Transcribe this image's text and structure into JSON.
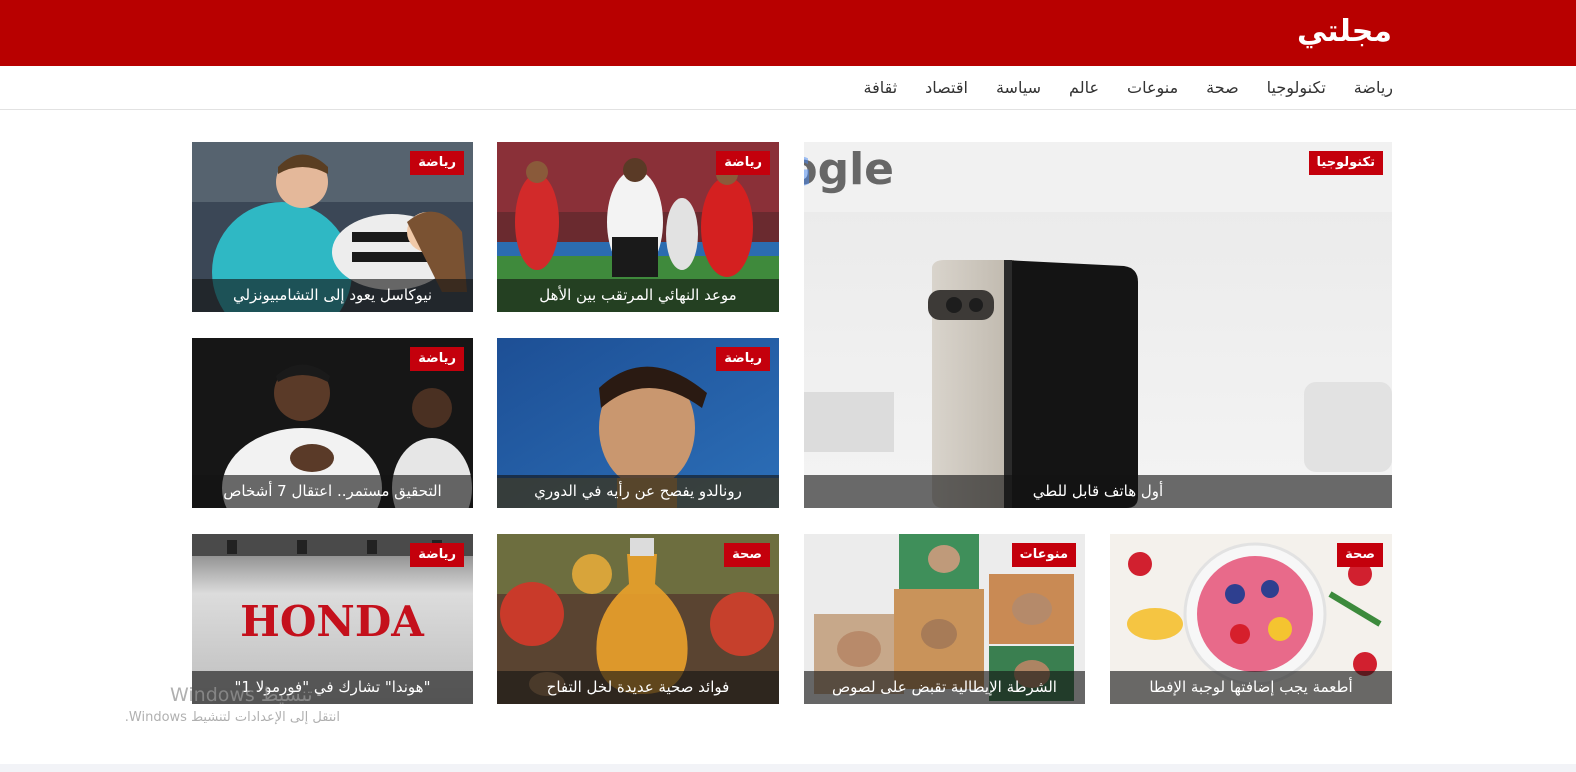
{
  "site": {
    "logo": "مجلتي"
  },
  "nav": {
    "items": [
      {
        "label": "رياضة"
      },
      {
        "label": "تكنولوجيا"
      },
      {
        "label": "صحة"
      },
      {
        "label": "منوعات"
      },
      {
        "label": "عالم"
      },
      {
        "label": "سياسة"
      },
      {
        "label": "اقتصاد"
      },
      {
        "label": "ثقافة"
      }
    ]
  },
  "articles": {
    "featured": {
      "category": "تكنولوجيا",
      "title": "أول هاتف قابل للطي",
      "image": "folding-phone-photo"
    },
    "a1": {
      "category": "رياضة",
      "title": "موعد النهائي المرتقب بين الأهل",
      "image": "football-match-photo"
    },
    "a2": {
      "category": "رياضة",
      "title": "نيوكاسل يعود إلى التشامبيونزلي",
      "image": "goalkeeper-child-photo"
    },
    "a3": {
      "category": "رياضة",
      "title": "رونالدو يفصح عن رأيه في الدوري",
      "image": "ronaldo-photo"
    },
    "a4": {
      "category": "رياضة",
      "title": "التحقيق مستمر.. اعتقال 7 أشخاص",
      "image": "vinicius-photo"
    },
    "a5": {
      "category": "صحة",
      "title": "أطعمة يجب إضافتها لوجبة الإفطا",
      "image": "fruit-bowl-photo"
    },
    "a6": {
      "category": "منوعات",
      "title": "الشرطة الإيطالية تقبض على لصوص",
      "image": "pottery-photo"
    },
    "a7": {
      "category": "صحة",
      "title": "فوائد صحية عديدة لخل التفاح",
      "image": "apple-vinegar-photo"
    },
    "a8": {
      "category": "رياضة",
      "title": "\"هوندا\" تشارك في \"فورمولا 1\"",
      "image": "honda-logo-photo",
      "logo_text": "HONDA"
    }
  },
  "watermark": {
    "line1": "Windows تنشيط",
    "line2": "انتقل إلى الإعدادات لتنشيط Windows."
  },
  "colors": {
    "brand": "#b80000",
    "badge": "#c4000c"
  }
}
